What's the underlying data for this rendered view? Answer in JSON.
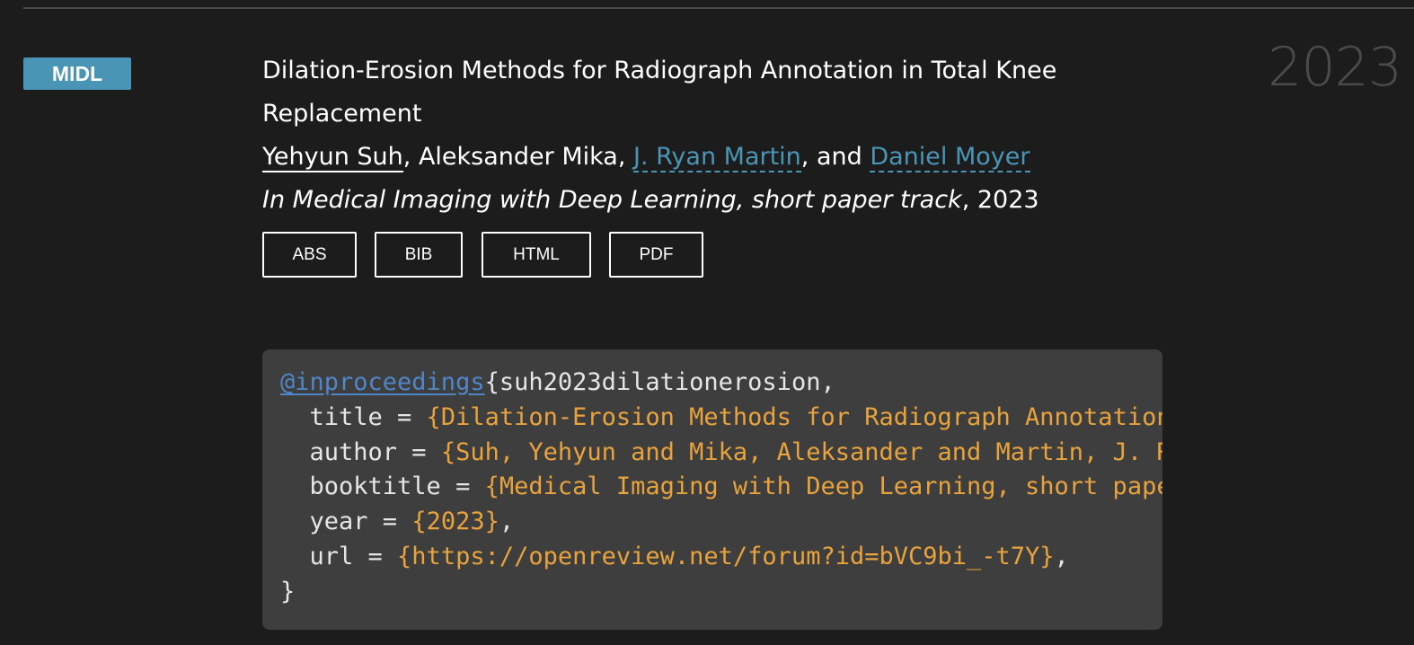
{
  "badge": {
    "label": "MIDL",
    "color": "#4a95b6"
  },
  "year_display": "2023",
  "publication": {
    "title": "Dilation-Erosion Methods for Radiograph Annotation in Total Knee Replacement",
    "authors": [
      {
        "name": "Yehyun Suh",
        "style": "self"
      },
      {
        "sep": ", "
      },
      {
        "name": "Aleksander Mika",
        "style": "plain"
      },
      {
        "sep": ", "
      },
      {
        "name": "J. Ryan Martin",
        "style": "link"
      },
      {
        "sep": ", and "
      },
      {
        "name": "Daniel Moyer",
        "style": "link"
      }
    ],
    "venue": "In Medical Imaging with Deep Learning, short paper track",
    "venue_year": ", 2023"
  },
  "buttons": [
    {
      "label": "ABS"
    },
    {
      "label": "BIB"
    },
    {
      "label": "HTML"
    },
    {
      "label": "PDF"
    }
  ],
  "bibtex": {
    "entry_type": "@inproceedings",
    "key": "{suh2023dilationerosion,",
    "fields": [
      {
        "name": "  title = ",
        "value": "{Dilation-Erosion Methods for Radiograph Annotation in Total Knee Replacement}",
        "tail": ","
      },
      {
        "name": "  author = ",
        "value": "{Suh, Yehyun and Mika, Aleksander and Martin, J. Ryan and Moyer, Daniel}",
        "tail": ","
      },
      {
        "name": "  booktitle = ",
        "value": "{Medical Imaging with Deep Learning, short paper track}",
        "tail": ","
      },
      {
        "name": "  year = ",
        "value": "{2023}",
        "tail": ","
      },
      {
        "name": "  url = ",
        "value": "{https://openreview.net/forum?id=bVC9bi_-t7Y}",
        "tail": ","
      }
    ],
    "closing": "}"
  },
  "colors": {
    "background": "#1c1c1d",
    "link": "#4a95b6",
    "code_background": "#3e3e3f",
    "code_keyword": "#4f86c6",
    "code_string": "#e8a33d"
  }
}
